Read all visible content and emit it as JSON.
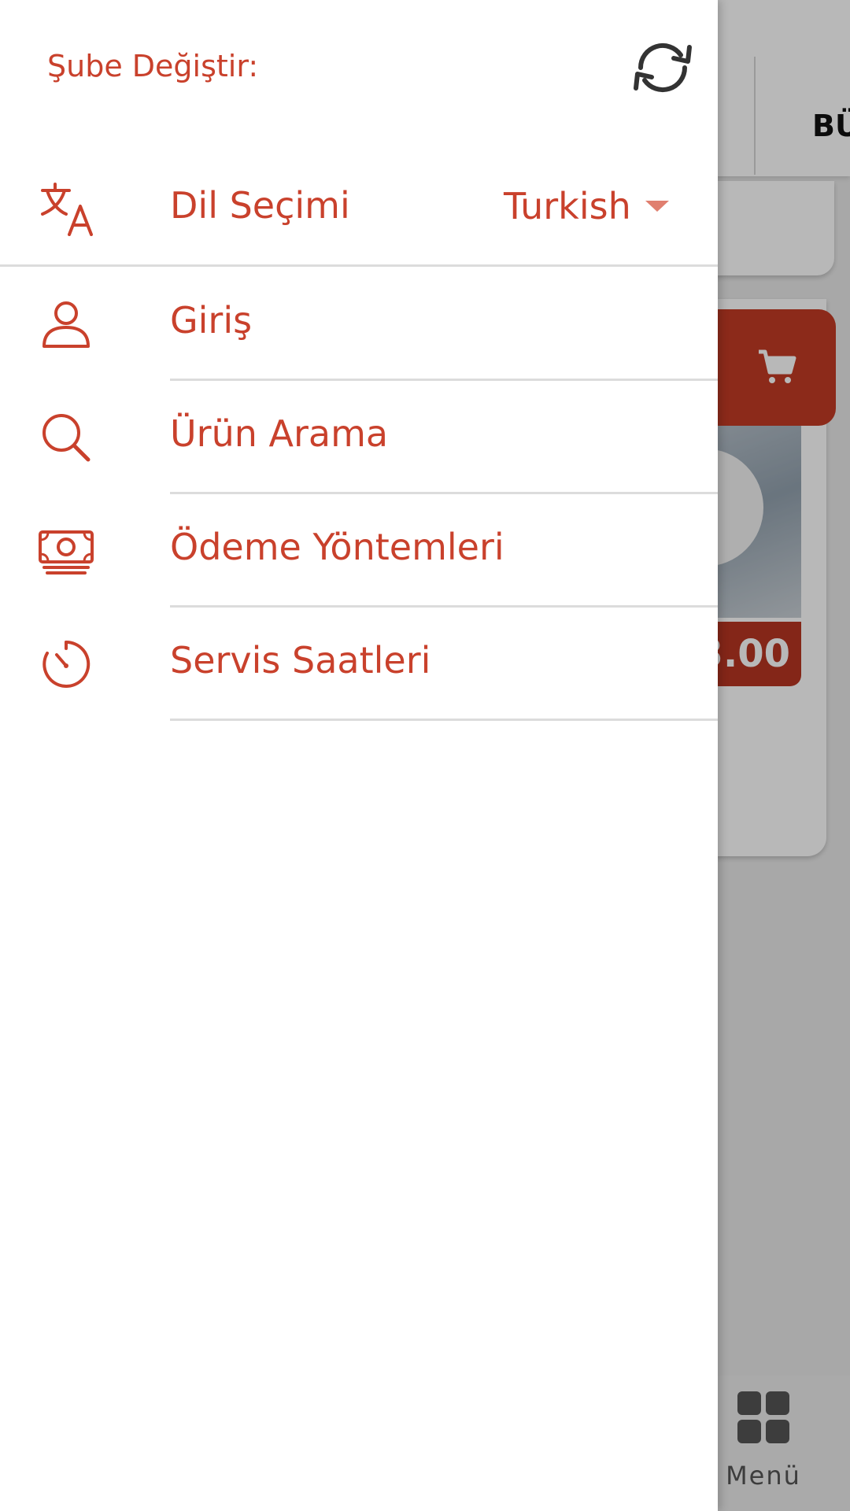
{
  "drawer": {
    "branch_label": "Şube Değiştir:",
    "language": {
      "label": "Dil Seçimi",
      "selected": "Turkish",
      "icon": "translate-icon"
    },
    "items": [
      {
        "label": "Giriş",
        "icon": "user-icon"
      },
      {
        "label": "Ürün Arama",
        "icon": "search-icon"
      },
      {
        "label": "Ödeme Yöntemleri",
        "icon": "money-icon"
      },
      {
        "label": "Servis Saatleri",
        "icon": "timer-icon"
      }
    ]
  },
  "background": {
    "tab_label": "BÜ",
    "price": "3.00",
    "bottom_nav": {
      "menu_label": "Menü"
    }
  },
  "colors": {
    "accent": "#c9412c",
    "cart_button": "#c23b24",
    "price_bar": "#b73522",
    "divider": "#dcdcdc"
  }
}
